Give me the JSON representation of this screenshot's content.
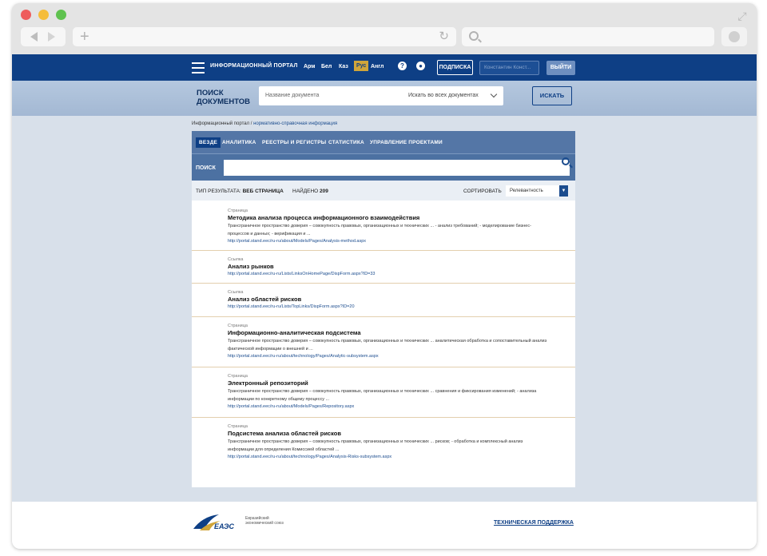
{
  "browser": {
    "url": "",
    "search": ""
  },
  "header": {
    "portal_title": "ИНФОРМАЦИОННЫЙ ПОРТАЛ",
    "languages": [
      "Арм",
      "Бел",
      "Каз",
      "Рус",
      "Англ"
    ],
    "active_language": "Рус",
    "subscribe_label": "ПОДПИСКА",
    "user_name": "Константин Конст...",
    "logout_label": "ВЫЙТИ"
  },
  "search_band": {
    "title": "ПОИСК ДОКУМЕНТОВ",
    "placeholder": "Название документа",
    "scope": "Искать во всех документах",
    "button": "ИСКАТЬ"
  },
  "breadcrumb": {
    "root": "Информационный портал",
    "separator": " / ",
    "current": "нормативно-справочная информация"
  },
  "tabs": [
    "ВЕЗДЕ",
    "АНАЛИТИКА",
    "РЕЕСТРЫ И РЕГИСТРЫ",
    "СТАТИСТИКА",
    "УПРАВЛЕНИЕ ПРОЕКТАМИ"
  ],
  "search_panel": {
    "label": "ПОИСК",
    "value": ""
  },
  "result_bar": {
    "type_label": "ТИП РЕЗУЛЬТАТА:",
    "type_value": "ВЕБ СТРАНИЦА",
    "found_label": "НАЙДЕНО",
    "found_count": "209",
    "sort_label": "СОРТИРОВАТЬ",
    "sort_value": "Релевантность"
  },
  "results": [
    {
      "kind": "Страница",
      "title": "Методика анализа процесса информационного взаимодействия",
      "desc": "Трансграничное пространство доверия – совокупность правовых, организационных и технических ... - анализ требований;  - моделирование бизнес-процессов и данных;  - верификация и ...",
      "url": "http://portal.stand.eec/ru-ru/about/Models/Pages/Analysis-method.aspx"
    },
    {
      "kind": "Ссылка",
      "title": "Анализ рынков",
      "desc": "",
      "url": "http://portal.stand.eec/ru-ru/Lists/LinksOnHomePage/DispForm.aspx?ID=33"
    },
    {
      "kind": "Ссылка",
      "title": "Анализ областей рисков",
      "desc": "",
      "url": "http://portal.stand.eec/ru-ru/Lists/TopLinks/DispForm.aspx?ID=20"
    },
    {
      "kind": "Страница",
      "title": "Информационно-аналитическая подсистема",
      "desc": "Трансграничное пространство доверия – совокупность правовых, организационных и технических ... аналитическая обработка и сопоставительный анализ фактической информации о внешней и ...",
      "url": "http://portal.stand.eec/ru-ru/about/technology/Pages/Analytic-subsystem.aspx"
    },
    {
      "kind": "Страница",
      "title": "Электронный репозиторий",
      "desc": "Трансграничное пространство доверия – совокупность правовых, организационных и технических ... сравнения и фиксирования изменений;  - анализа информации по конкретному общему процессу ...",
      "url": "http://portal.stand.eec/ru-ru/about/Models/Pages/Repository.aspx"
    },
    {
      "kind": "Страница",
      "title": "Подсистема анализа областей рисков",
      "desc": "Трансграничное пространство доверия – совокупность правовых, организационных и технических ... рисков;  - обработка и комплексный анализ информации для определения Комиссией областей ...",
      "url": "http://portal.stand.eec/ru-ru/about/technology/Pages/Analysis-Risks-subsystem.aspx"
    }
  ],
  "footer": {
    "logo_text": "ЕАЭС",
    "logo_sub": "Евразийский экономический союз",
    "support": "ТЕХНИЧЕСКАЯ ПОДДЕРЖКА"
  },
  "colors": {
    "brand_dark": "#0e3f85",
    "tabs_bg": "#5476a6",
    "accent_gold": "#d0a53a"
  }
}
